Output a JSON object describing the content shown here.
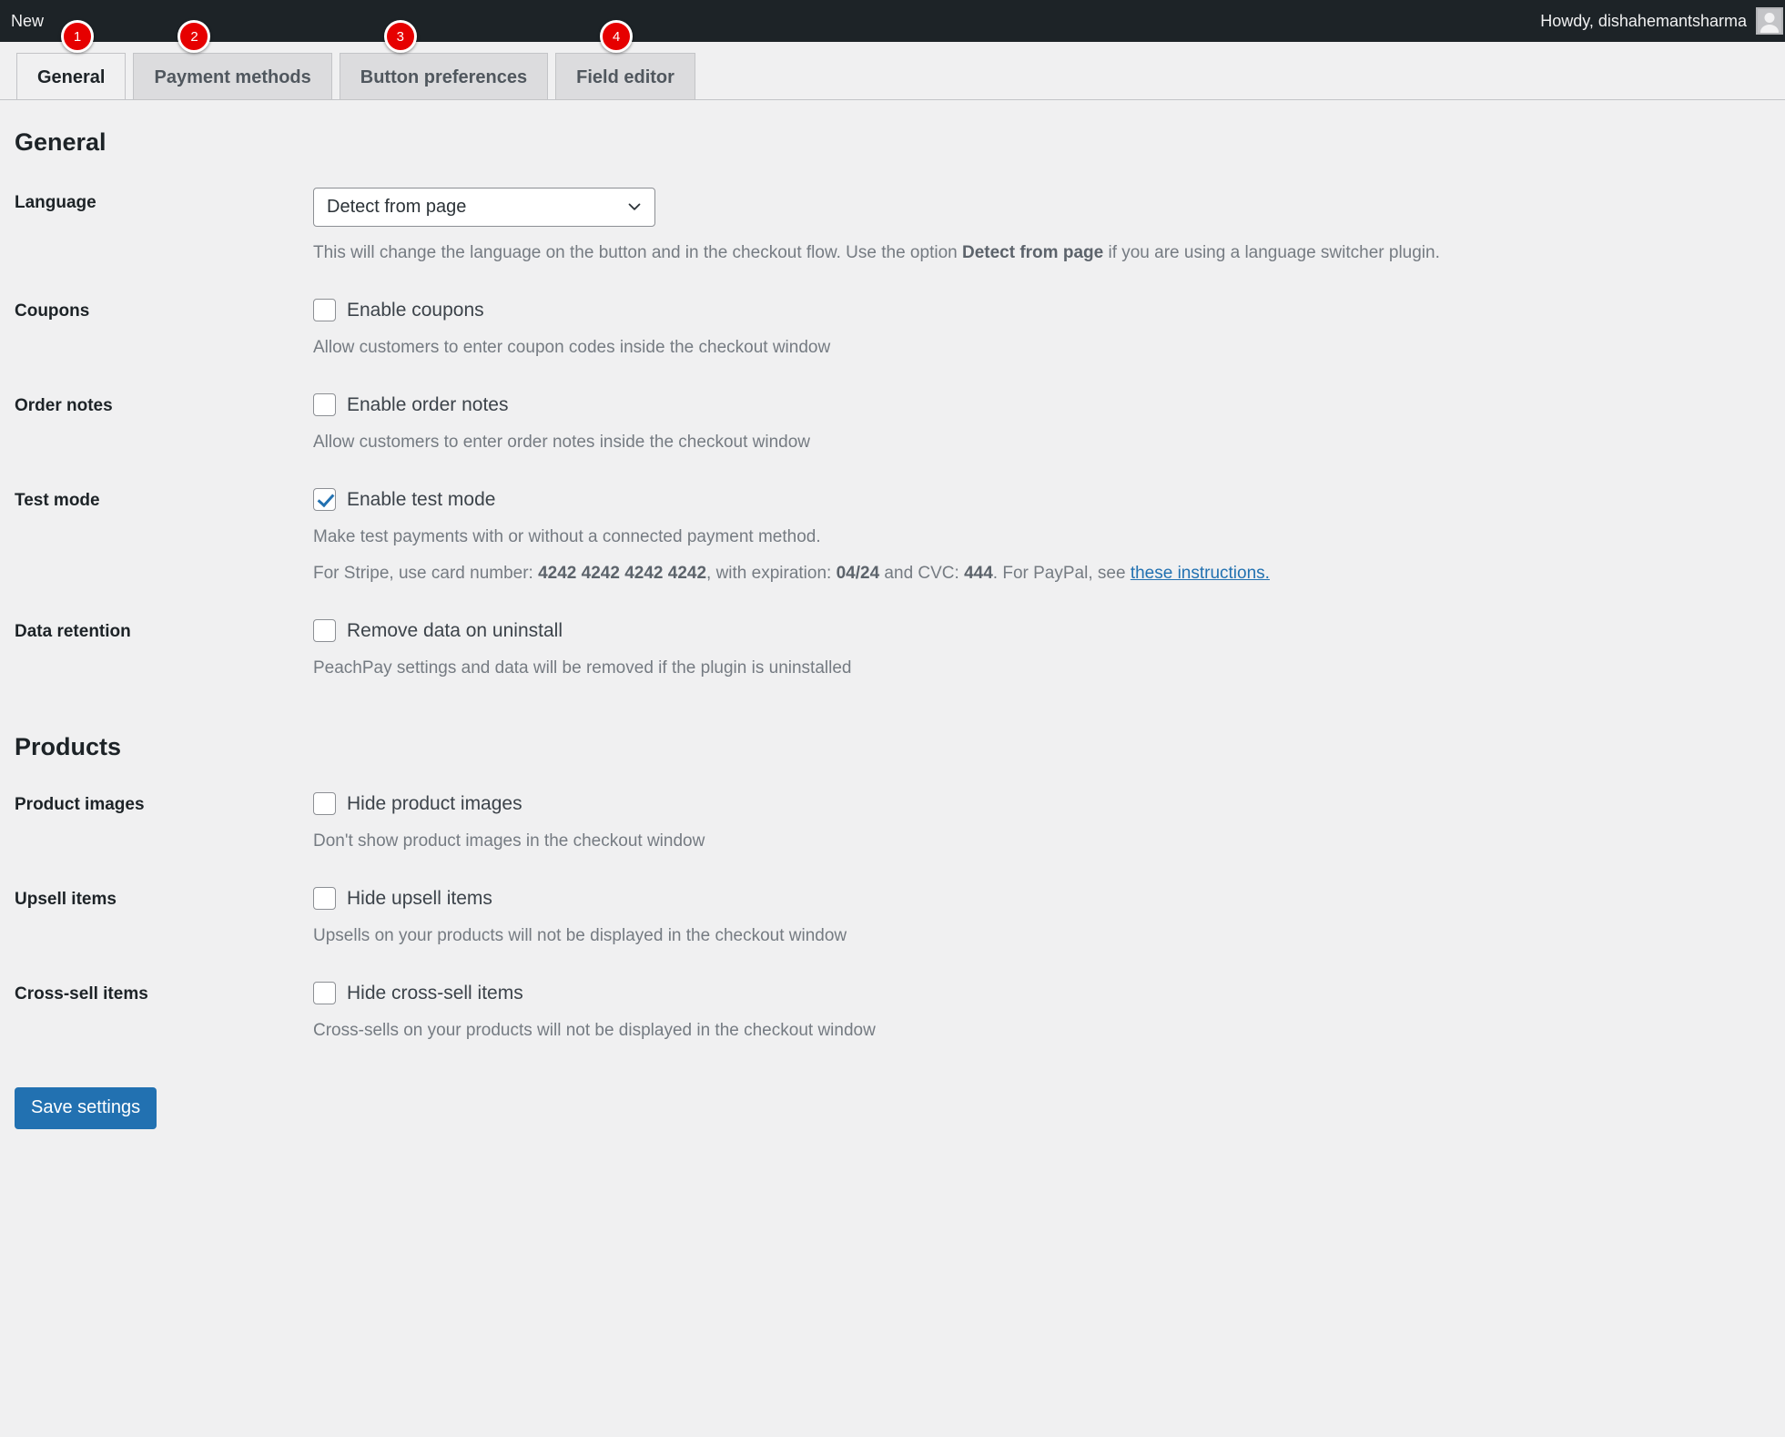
{
  "adminbar": {
    "new_label": "New",
    "howdy": "Howdy, dishahemantsharma",
    "avatar_icon": "user-avatar-icon"
  },
  "tabs": [
    {
      "label": "General",
      "badge": "1",
      "active": true
    },
    {
      "label": "Payment methods",
      "badge": "2",
      "active": false
    },
    {
      "label": "Button preferences",
      "badge": "3",
      "active": false
    },
    {
      "label": "Field editor",
      "badge": "4",
      "active": false
    }
  ],
  "sections": {
    "general_title": "General",
    "products_title": "Products"
  },
  "language": {
    "label": "Language",
    "selected": "Detect from page",
    "chevron_icon": "chevron-down-icon",
    "desc_part1": "This will change the language on the button and in the checkout flow. Use the option ",
    "desc_bold": "Detect from page",
    "desc_part2": " if you are using a language switcher plugin."
  },
  "coupons": {
    "label": "Coupons",
    "checkbox_label": "Enable coupons",
    "checked": false,
    "desc": "Allow customers to enter coupon codes inside the checkout window"
  },
  "order_notes": {
    "label": "Order notes",
    "checkbox_label": "Enable order notes",
    "checked": false,
    "desc": "Allow customers to enter order notes inside the checkout window"
  },
  "test_mode": {
    "label": "Test mode",
    "checkbox_label": "Enable test mode",
    "checked": true,
    "desc1": "Make test payments with or without a connected payment method.",
    "desc2_a": "For Stripe, use card number: ",
    "card_number": "4242 4242 4242 4242",
    "desc2_b": ",  with expiration: ",
    "expiration": "04/24",
    "desc2_c": " and CVC: ",
    "cvc": "444",
    "desc2_d": ".  For PayPal, see ",
    "link_text": "these instructions."
  },
  "data_retention": {
    "label": "Data retention",
    "checkbox_label": "Remove data on uninstall",
    "checked": false,
    "desc": "PeachPay settings and data will be removed if the plugin is uninstalled"
  },
  "product_images": {
    "label": "Product images",
    "checkbox_label": "Hide product images",
    "checked": false,
    "desc": "Don't show product images in the checkout window"
  },
  "upsell_items": {
    "label": "Upsell items",
    "checkbox_label": "Hide upsell items",
    "checked": false,
    "desc": "Upsells on your products will not be displayed in the checkout window"
  },
  "cross_sell_items": {
    "label": "Cross-sell items",
    "checkbox_label": "Hide cross-sell items",
    "checked": false,
    "desc": "Cross-sells on your products will not be displayed in the checkout window"
  },
  "footer": {
    "save_label": "Save settings"
  },
  "colors": {
    "accent": "#2271b1",
    "badge": "#e60000",
    "adminbar": "#1d2327",
    "page_bg": "#f0f0f1"
  }
}
